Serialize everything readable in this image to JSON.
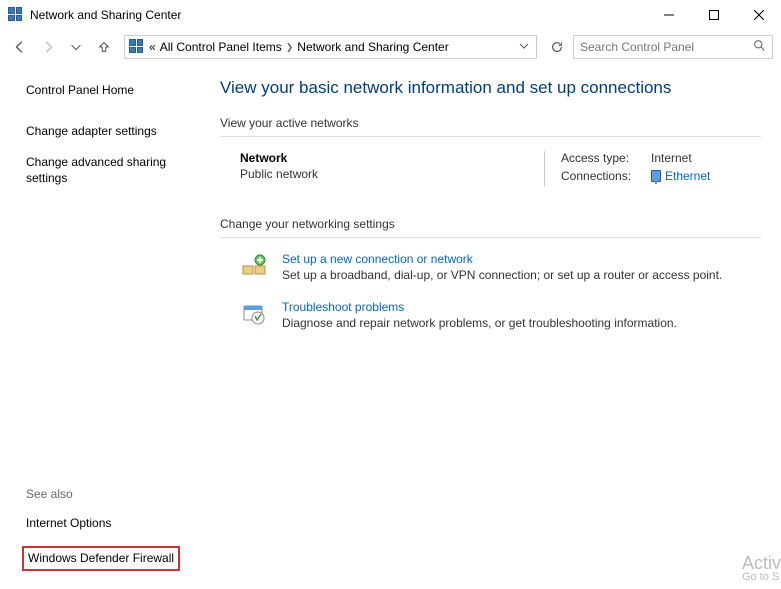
{
  "window": {
    "title": "Network and Sharing Center"
  },
  "breadcrumb": {
    "prefix": "«",
    "items": [
      "All Control Panel Items",
      "Network and Sharing Center"
    ]
  },
  "search": {
    "placeholder": "Search Control Panel"
  },
  "sidebar": {
    "home": "Control Panel Home",
    "links": [
      "Change adapter settings",
      "Change advanced sharing settings"
    ],
    "see_also_label": "See also",
    "see_also": [
      "Internet Options",
      "Windows Defender Firewall"
    ]
  },
  "main": {
    "heading": "View your basic network information and set up connections",
    "active_label": "View your active networks",
    "network": {
      "name": "Network",
      "type": "Public network",
      "access_label": "Access type:",
      "access_value": "Internet",
      "conn_label": "Connections:",
      "conn_value": "Ethernet"
    },
    "change_label": "Change your networking settings",
    "actions": [
      {
        "title": "Set up a new connection or network",
        "desc": "Set up a broadband, dial-up, or VPN connection; or set up a router or access point."
      },
      {
        "title": "Troubleshoot problems",
        "desc": "Diagnose and repair network problems, or get troubleshooting information."
      }
    ]
  },
  "watermark": {
    "line1": "Activ",
    "line2": "Go to S"
  }
}
